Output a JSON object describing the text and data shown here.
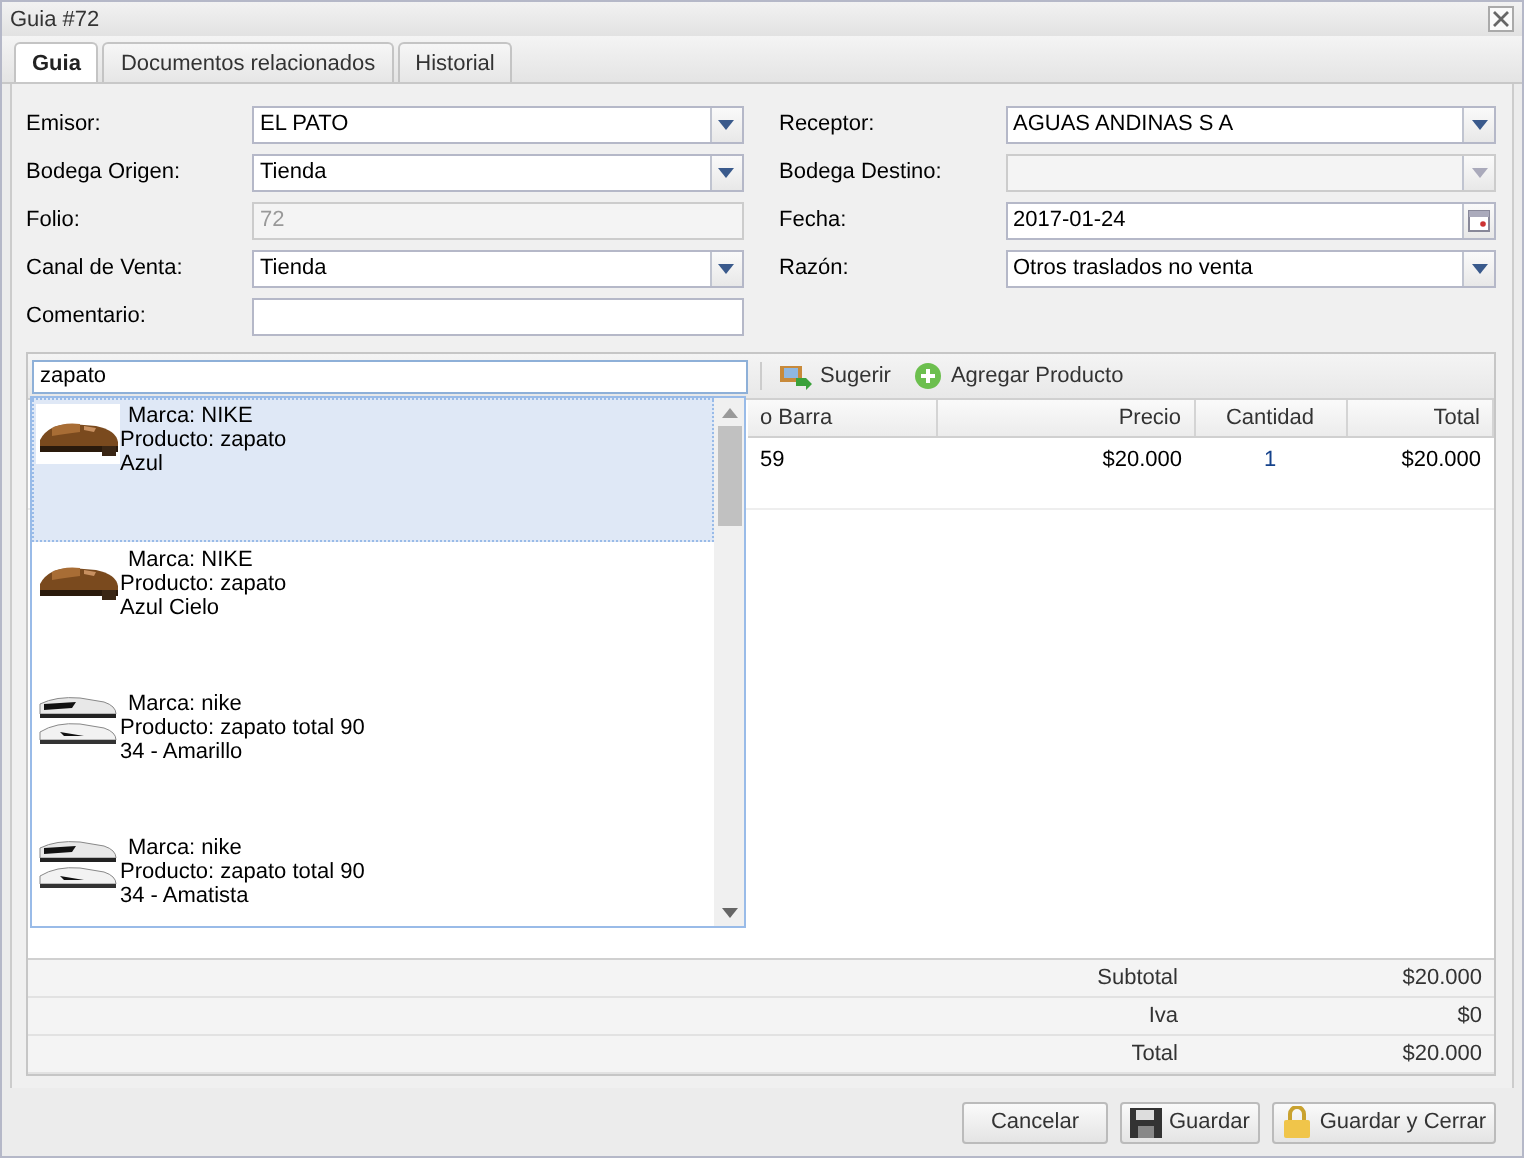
{
  "window": {
    "title": "Guia #72"
  },
  "tabs": [
    {
      "label": "Guia",
      "selected": true
    },
    {
      "label": "Documentos relacionados",
      "selected": false
    },
    {
      "label": "Historial",
      "selected": false
    }
  ],
  "form": {
    "left": [
      {
        "label": "Emisor:",
        "kind": "select",
        "value": "EL PATO",
        "disabled": false
      },
      {
        "label": "Bodega Origen:",
        "kind": "select",
        "value": "Tienda",
        "disabled": false
      },
      {
        "label": "Folio:",
        "kind": "text",
        "value": "72",
        "disabled": true
      },
      {
        "label": "Canal de Venta:",
        "kind": "select",
        "value": "Tienda",
        "disabled": false
      },
      {
        "label": "Comentario:",
        "kind": "text",
        "disabled": false
      }
    ],
    "right": [
      {
        "label": "Receptor:",
        "kind": "select",
        "value": "AGUAS ANDINAS S A",
        "disabled": false
      },
      {
        "label": "Bodega Destino:",
        "kind": "select",
        "disabled": true
      },
      {
        "label": "Fecha:",
        "kind": "date",
        "value": "2017-01-24",
        "disabled": false
      },
      {
        "label": "Razón:",
        "kind": "select",
        "value": "Otros traslados no venta",
        "disabled": false
      }
    ]
  },
  "search": {
    "value": "zapato"
  },
  "toolbar": [
    {
      "label": "Sugerir",
      "kind": "suggest"
    },
    {
      "label": "Agregar Producto",
      "kind": "add"
    }
  ],
  "suggestions": [
    {
      "brand": "Marca: NIKE",
      "product": "Producto: zapato",
      "variant": "Azul",
      "selected": true
    },
    {
      "brand": "Marca: NIKE",
      "product": "Producto: zapato",
      "variant": "Azul Cielo",
      "selected": false
    },
    {
      "brand": "Marca: nike",
      "product": "Producto: zapato total 90",
      "variant": "34 - Amarillo",
      "selected": false
    },
    {
      "brand": "Marca: nike",
      "product": "Producto: zapato total 90",
      "variant": "34 - Amatista",
      "selected": false
    }
  ],
  "grid": {
    "columns": [
      {
        "label": "o Barra"
      },
      {
        "label": "Precio"
      },
      {
        "label": "Cantidad"
      },
      {
        "label": "Total"
      }
    ],
    "rows": [
      {
        "cells": [
          "59",
          "$20.000",
          "1",
          "$20.000"
        ]
      }
    ],
    "summary": [
      {
        "label": "Subtotal",
        "value": "$20.000"
      },
      {
        "label": "Iva",
        "value": "$0"
      },
      {
        "label": "Total",
        "value": "$20.000"
      }
    ]
  },
  "buttons": [
    {
      "label": "Cancelar"
    },
    {
      "label": "Guardar"
    },
    {
      "label": "Guardar y Cerrar"
    }
  ]
}
